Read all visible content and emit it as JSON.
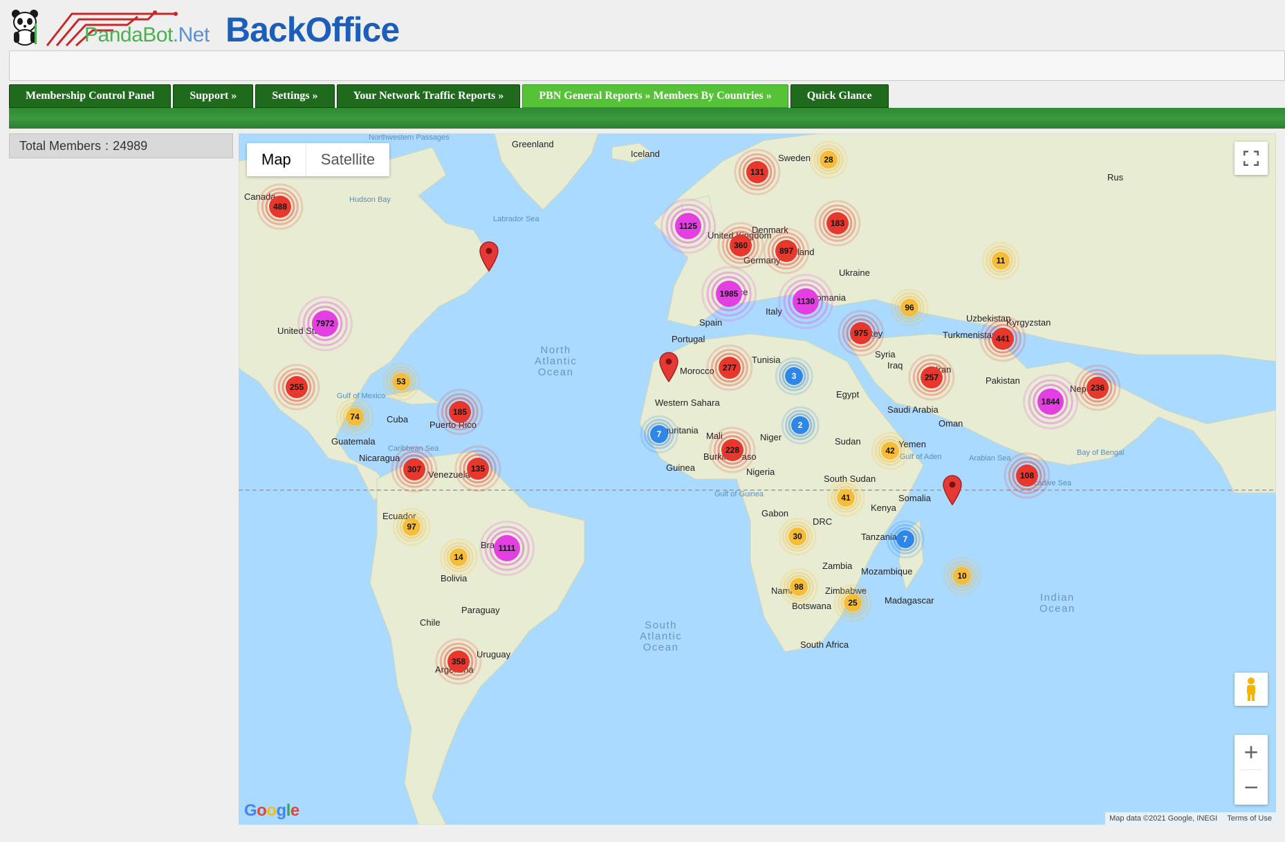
{
  "header": {
    "logo_left": "PandaBot",
    "logo_dot": ".Net",
    "logo_right": "BackOffice"
  },
  "nav": [
    {
      "label": "Membership Control Panel"
    },
    {
      "label": "Support »"
    },
    {
      "label": "Settings »"
    },
    {
      "label": "Your Network Traffic Reports »"
    },
    {
      "label": "PBN General Reports » Members By Countries  »",
      "active": true
    },
    {
      "label": "Quick Glance"
    }
  ],
  "summary": {
    "label": "Total Members",
    "separator": ":",
    "value": "24989"
  },
  "map": {
    "type_options": [
      "Map",
      "Satellite"
    ],
    "selected_type": "Map",
    "google_logo": "Google",
    "attribution_data": "Map data ©2021 Google, INEGI",
    "attribution_terms": "Terms of Use",
    "colors": {
      "water": "#aadaff",
      "land": "#e8ecd2",
      "red": "#e8372c",
      "magenta": "#e43fe2",
      "orange": "#f7bd38",
      "blue": "#2e86e8"
    },
    "labels": [
      {
        "text": "Greenland",
        "cls": "country"
      },
      {
        "text": "Iceland",
        "cls": "country"
      },
      {
        "text": "Sweden",
        "cls": "country"
      },
      {
        "text": "Canada",
        "cls": "country"
      },
      {
        "text": "Hudson Bay",
        "cls": "sea"
      },
      {
        "text": "Labrador Sea",
        "cls": "sea"
      },
      {
        "text": "Northwestern Passages",
        "cls": "sea"
      },
      {
        "text": "United Kingdom",
        "cls": "country"
      },
      {
        "text": "Denmark",
        "cls": "country"
      },
      {
        "text": "Poland",
        "cls": "country"
      },
      {
        "text": "Ukraine",
        "cls": "country"
      },
      {
        "text": "Germany",
        "cls": "country"
      },
      {
        "text": "France",
        "cls": "country"
      },
      {
        "text": "Romania",
        "cls": "country"
      },
      {
        "text": "Italy",
        "cls": "country"
      },
      {
        "text": "Spain",
        "cls": "country"
      },
      {
        "text": "Portugal",
        "cls": "country"
      },
      {
        "text": "Turkey",
        "cls": "country"
      },
      {
        "text": "Syria",
        "cls": "country"
      },
      {
        "text": "Iraq",
        "cls": "country"
      },
      {
        "text": "Iran",
        "cls": "country"
      },
      {
        "text": "Uzbekistan",
        "cls": "country"
      },
      {
        "text": "Kyrgyzstan",
        "cls": "country"
      },
      {
        "text": "Turkmenistan",
        "cls": "country"
      },
      {
        "text": "Pakistan",
        "cls": "country"
      },
      {
        "text": "Nepal",
        "cls": "country"
      },
      {
        "text": "Morocco",
        "cls": "country"
      },
      {
        "text": "Tunisia",
        "cls": "country"
      },
      {
        "text": "Egypt",
        "cls": "country"
      },
      {
        "text": "Saudi Arabia",
        "cls": "country"
      },
      {
        "text": "Oman",
        "cls": "country"
      },
      {
        "text": "Yemen",
        "cls": "country"
      },
      {
        "text": "Western Sahara",
        "cls": "country"
      },
      {
        "text": "Mauritania",
        "cls": "country"
      },
      {
        "text": "Mali",
        "cls": "country"
      },
      {
        "text": "Niger",
        "cls": "country"
      },
      {
        "text": "Sudan",
        "cls": "country"
      },
      {
        "text": "South Sudan",
        "cls": "country"
      },
      {
        "text": "Guinea",
        "cls": "country"
      },
      {
        "text": "Burkina Faso",
        "cls": "country"
      },
      {
        "text": "Nigeria",
        "cls": "country"
      },
      {
        "text": "Gulf of Guinea",
        "cls": "sea"
      },
      {
        "text": "Gulf of Aden",
        "cls": "sea"
      },
      {
        "text": "Arabian Sea",
        "cls": "sea"
      },
      {
        "text": "Bay of Bengal",
        "cls": "sea"
      },
      {
        "text": "Laccadive Sea",
        "cls": "sea"
      },
      {
        "text": "Somalia",
        "cls": "country"
      },
      {
        "text": "Kenya",
        "cls": "country"
      },
      {
        "text": "Gabon",
        "cls": "country"
      },
      {
        "text": "DRC",
        "cls": "country"
      },
      {
        "text": "Tanzania",
        "cls": "country"
      },
      {
        "text": "Zambia",
        "cls": "country"
      },
      {
        "text": "Mozambique",
        "cls": "country"
      },
      {
        "text": "Zimbabwe",
        "cls": "country"
      },
      {
        "text": "Namibia",
        "cls": "country"
      },
      {
        "text": "Botswana",
        "cls": "country"
      },
      {
        "text": "Madagascar",
        "cls": "country"
      },
      {
        "text": "South Africa",
        "cls": "country"
      },
      {
        "text": "United States",
        "cls": "country"
      },
      {
        "text": "Gulf of Mexico",
        "cls": "sea"
      },
      {
        "text": "Cuba",
        "cls": "country"
      },
      {
        "text": "Puerto Rico",
        "cls": "country"
      },
      {
        "text": "Caribbean Sea",
        "cls": "sea"
      },
      {
        "text": "Guatemala",
        "cls": "country"
      },
      {
        "text": "Nicaragua",
        "cls": "country"
      },
      {
        "text": "Venezuela",
        "cls": "country"
      },
      {
        "text": "Ecuador",
        "cls": "country"
      },
      {
        "text": "Brazil",
        "cls": "country"
      },
      {
        "text": "Bolivia",
        "cls": "country"
      },
      {
        "text": "Paraguay",
        "cls": "country"
      },
      {
        "text": "Chile",
        "cls": "country"
      },
      {
        "text": "Uruguay",
        "cls": "country"
      },
      {
        "text": "Argentina",
        "cls": "country"
      },
      {
        "text": "North Atlantic Ocean",
        "cls": "ocean"
      },
      {
        "text": "South Atlantic Ocean",
        "cls": "ocean"
      },
      {
        "text": "Indian Ocean",
        "cls": "ocean"
      },
      {
        "text": "Rus",
        "cls": "country"
      }
    ],
    "clusters": [
      {
        "count": "488",
        "color": "red"
      },
      {
        "count": "131",
        "color": "red"
      },
      {
        "count": "28",
        "color": "orange"
      },
      {
        "count": "1125",
        "color": "magenta"
      },
      {
        "count": "183",
        "color": "red"
      },
      {
        "count": "360",
        "color": "red"
      },
      {
        "count": "897",
        "color": "red"
      },
      {
        "count": "11",
        "color": "orange"
      },
      {
        "count": "1985",
        "color": "magenta"
      },
      {
        "count": "1130",
        "color": "magenta"
      },
      {
        "count": "96",
        "color": "orange"
      },
      {
        "count": "7972",
        "color": "magenta"
      },
      {
        "count": "975",
        "color": "red"
      },
      {
        "count": "441",
        "color": "red"
      },
      {
        "count": "277",
        "color": "red"
      },
      {
        "count": "3",
        "color": "blue"
      },
      {
        "count": "257",
        "color": "red"
      },
      {
        "count": "236",
        "color": "red"
      },
      {
        "count": "1844",
        "color": "magenta"
      },
      {
        "count": "255",
        "color": "red"
      },
      {
        "count": "53",
        "color": "orange"
      },
      {
        "count": "185",
        "color": "red"
      },
      {
        "count": "74",
        "color": "orange"
      },
      {
        "count": "7",
        "color": "blue"
      },
      {
        "count": "2",
        "color": "blue"
      },
      {
        "count": "228",
        "color": "red"
      },
      {
        "count": "42",
        "color": "orange"
      },
      {
        "count": "108",
        "color": "red"
      },
      {
        "count": "307",
        "color": "red"
      },
      {
        "count": "135",
        "color": "red"
      },
      {
        "count": "41",
        "color": "orange"
      },
      {
        "count": "97",
        "color": "orange"
      },
      {
        "count": "7",
        "color": "blue"
      },
      {
        "count": "30",
        "color": "orange"
      },
      {
        "count": "14",
        "color": "orange"
      },
      {
        "count": "1111",
        "color": "magenta"
      },
      {
        "count": "10",
        "color": "orange"
      },
      {
        "count": "98",
        "color": "orange"
      },
      {
        "count": "25",
        "color": "orange"
      },
      {
        "count": "358",
        "color": "red"
      }
    ],
    "pins": [
      {
        "name": "newfoundland"
      },
      {
        "name": "western-sahara"
      },
      {
        "name": "indian-ocean"
      }
    ]
  }
}
